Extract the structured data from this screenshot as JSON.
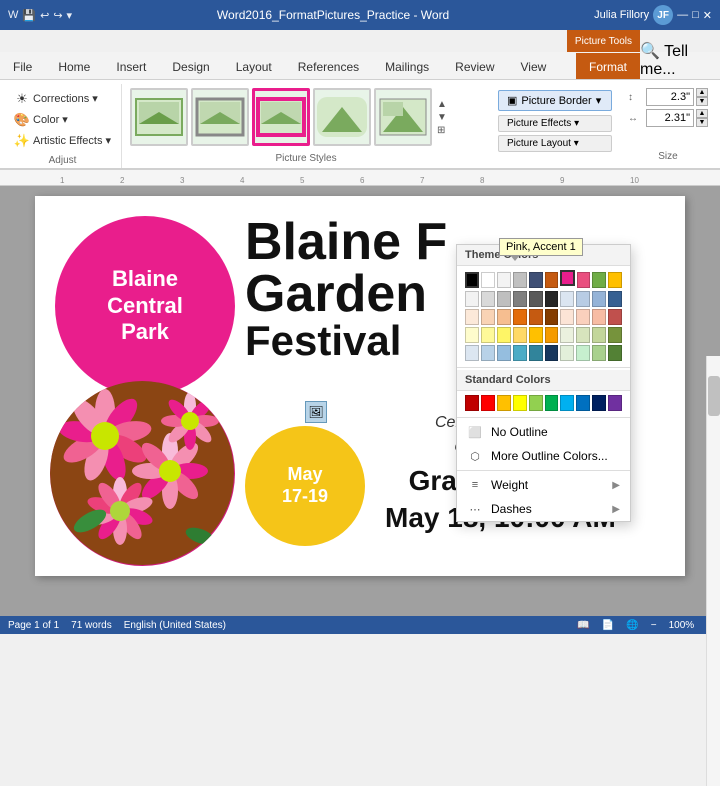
{
  "titlebar": {
    "app_title": "Word2016_FormatPictures_Practice - Word",
    "picture_tools_label": "Picture Tools",
    "user_name": "Julia Fillory"
  },
  "tabs": {
    "main": [
      "File",
      "Home",
      "Insert",
      "Design",
      "Layout",
      "References",
      "Mailings",
      "Review",
      "View"
    ],
    "format_tab": "Format",
    "active": "Format"
  },
  "ribbon": {
    "adjust_label": "Adjust",
    "corrections_btn": "Corrections",
    "color_btn": "Color",
    "artistic_btn": "Artistic Effects",
    "picture_styles_label": "Picture Styles",
    "picture_border_btn": "Picture Border",
    "size_label": "Size",
    "height_val": "2.3\"",
    "width_val": "2.31\""
  },
  "dropdown": {
    "theme_colors_label": "Theme Colors",
    "standard_colors_label": "Standard Colors",
    "no_outline": "No Outline",
    "more_colors": "More Outline Colors...",
    "weight": "Weight",
    "dashes": "Dashes",
    "tooltip": "Pink, Accent 1",
    "theme_colors": [
      "#000000",
      "#ffffff",
      "#f3f3f3",
      "#c0c0c0",
      "#3f4f75",
      "#c55a11",
      "#e91e8c",
      "#e94f7f",
      "#70ad47",
      "#ffc000",
      "#4472c4",
      "#ed7d31",
      "#a5a5a5",
      "#ffd966",
      "#2e74b5",
      "#538135",
      "#833c00",
      "#843c0c",
      "#375623",
      "#7f3f98",
      "#9dc3e6",
      "#f8cbad",
      "#ffe699",
      "#c5e0b4",
      "#b4c6e7",
      "#d9d9d9",
      "#2e74b5",
      "#e36c09",
      "#e91e8c",
      "#538135",
      "#7030a0",
      "#c00000",
      "#1f3864",
      "#843c00",
      "#c55a11",
      "#375623",
      "#4f2b6e",
      "#600000"
    ],
    "standard_colors": [
      "#c00000",
      "#ff0000",
      "#ffc000",
      "#ffff00",
      "#92d050",
      "#00b050",
      "#00b0f0",
      "#0070c0",
      "#002060",
      "#7030a0"
    ]
  },
  "document": {
    "pink_circle_text": "Blaine\nCentral\nPark",
    "title_line1": "Blaine F",
    "title_line2": "Garden",
    "title_line3": "Festival",
    "yellow_text": "May\n17-19",
    "subtitle1": "Celebrating the beauty",
    "subtitle2": "of Central California",
    "parade_line1": "Grand Parade",
    "parade_line2": "May 18, 10:00 AM"
  },
  "status": {
    "page_info": "Page 1 of 1",
    "word_count": "71 words",
    "language": "English (United States)"
  }
}
